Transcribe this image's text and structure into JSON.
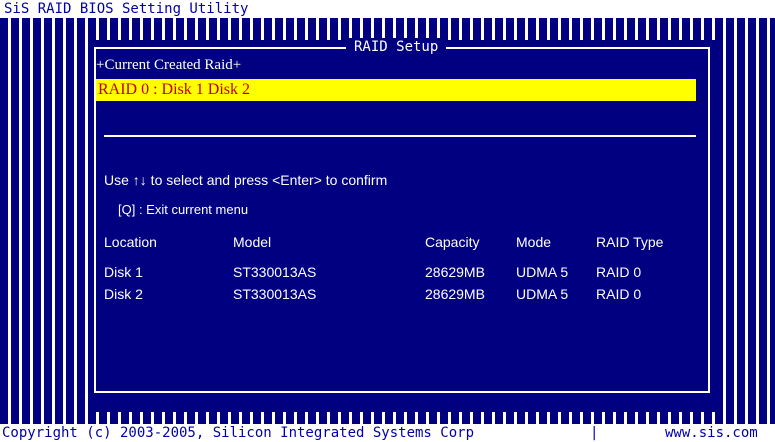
{
  "header": {
    "title": "SiS RAID BIOS Setting Utility"
  },
  "dialog": {
    "title": "RAID Setup",
    "section_title": "Current Created Raid",
    "selected_raid": "RAID 0  : Disk 1   Disk 2",
    "hint": "Use ↑↓ to select and press <Enter> to confirm",
    "exit_hint": "[Q] : Exit current menu"
  },
  "table": {
    "columns": [
      "Location",
      "Model",
      "Capacity",
      "Mode",
      "RAID Type"
    ],
    "rows": [
      [
        "Disk 1",
        "ST330013AS",
        "28629MB",
        "UDMA 5",
        "RAID 0"
      ],
      [
        "Disk 2",
        "ST330013AS",
        "28629MB",
        "UDMA 5",
        "RAID 0"
      ]
    ]
  },
  "footer": {
    "copyright": "Copyright (c) 2003-2005, Silicon Integrated Systems Corp",
    "separator": "|",
    "url": "www.sis.com"
  },
  "colors": {
    "background": "#000080",
    "highlight": "#ffff00",
    "highlight_text": "#c00000",
    "text": "#ffffff"
  }
}
